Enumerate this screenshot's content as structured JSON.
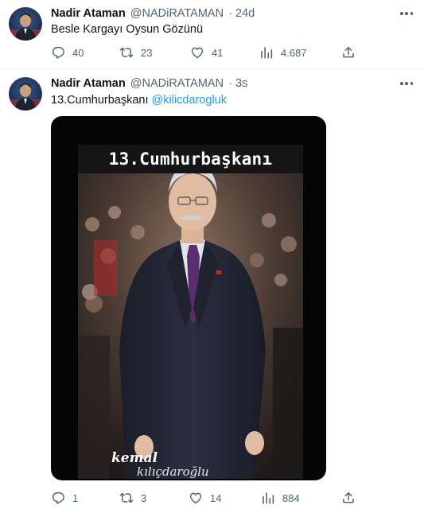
{
  "tweets": [
    {
      "author_name": "Nadir Ataman",
      "handle": "@NADiRATAMAN",
      "time": "· 24d",
      "text": "Besle Kargayı Oysun Gözünü",
      "mention": "",
      "stats": {
        "replies": "40",
        "retweets": "23",
        "likes": "41",
        "views": "4.687"
      }
    },
    {
      "author_name": "Nadir Ataman",
      "handle": "@NADiRATAMAN",
      "time": "· 3s",
      "text": "13.Cumhurbaşkanı ",
      "mention": "@kilicdarogluk",
      "stats": {
        "replies": "1",
        "retweets": "3",
        "likes": "14",
        "views": "884"
      },
      "media": {
        "title": "13.Cumhurbaşkanı",
        "signature_top": "kemal",
        "signature_bottom": "kılıçdaroğlu"
      }
    }
  ],
  "icons": {
    "reply": "reply-icon",
    "retweet": "retweet-icon",
    "like": "like-icon",
    "views": "views-icon",
    "share": "share-icon",
    "more": "more-icon"
  },
  "colors": {
    "text": "#0f1419",
    "secondary": "#536471",
    "link": "#1d9bf0",
    "divider": "#eff3f4"
  }
}
